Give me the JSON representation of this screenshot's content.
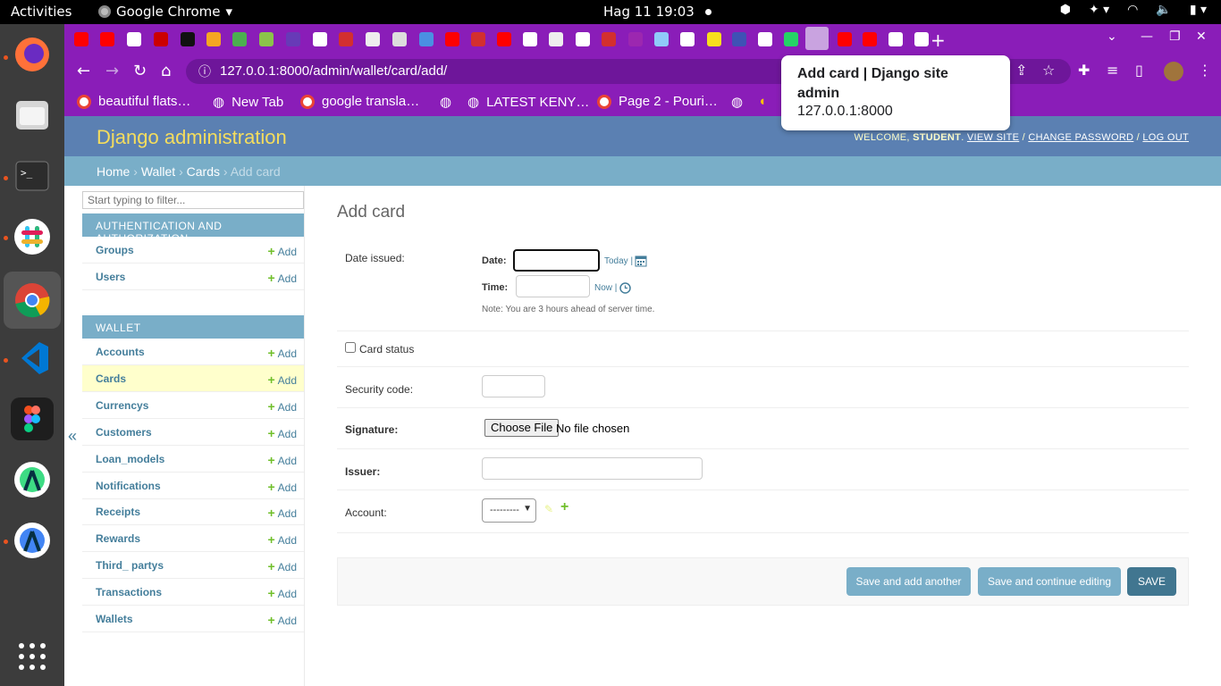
{
  "os": {
    "activities": "Activities",
    "app_name": "Google Chrome",
    "clock": "Hag 11  19:03"
  },
  "browser": {
    "url": "127.0.0.1:8000/admin/wallet/card/add/",
    "tooltip_title": "Add card | Django site admin",
    "tooltip_host": "127.0.0.1:8000",
    "bookmarks": [
      "beautiful flats…",
      "New Tab",
      "google transla…",
      "LATEST KENY…",
      "Page 2 - Pouri…"
    ]
  },
  "header": {
    "branding": "Django administration",
    "welcome": "WELCOME,",
    "user": "STUDENT",
    "view_site": "VIEW SITE",
    "change_password": "CHANGE PASSWORD",
    "logout": "LOG OUT",
    "sep": " / "
  },
  "breadcrumbs": {
    "home": "Home",
    "app": "Wallet",
    "model": "Cards",
    "current": "Add card",
    "sep": " › "
  },
  "sidebar": {
    "filter_placeholder": "Start typing to filter...",
    "auth_caption": "AUTHENTICATION AND AUTHORIZATION",
    "auth_models": [
      "Groups",
      "Users"
    ],
    "wallet_caption": "WALLET",
    "wallet_models": [
      "Accounts",
      "Cards",
      "Currencys",
      "Customers",
      "Loan_models",
      "Notifications",
      "Receipts",
      "Rewards",
      "Third_ partys",
      "Transactions",
      "Wallets"
    ],
    "add_label": "Add",
    "collapse": "«"
  },
  "form": {
    "title": "Add card",
    "date_issued_label": "Date issued:",
    "date_label": "Date:",
    "today_link": "Today |",
    "time_label": "Time:",
    "now_link": "Now |",
    "tz_note": "Note: You are 3 hours ahead of server time.",
    "card_status_label": "Card status",
    "security_code_label": "Security code:",
    "signature_label": "Signature:",
    "choose_file": "Choose File",
    "no_file": "No file chosen",
    "issuer_label": "Issuer:",
    "account_label": "Account:",
    "account_selected": "---------"
  },
  "buttons": {
    "save_add_another": "Save and add another",
    "save_continue": "Save and continue editing",
    "save": "SAVE"
  },
  "colors": {
    "chrome_theme": "#8a1db8",
    "django_header": "#5b80b2",
    "breadcrumbs": "#79aec8",
    "branding": "#f5dd5d",
    "active_row": "#ffffcc"
  }
}
